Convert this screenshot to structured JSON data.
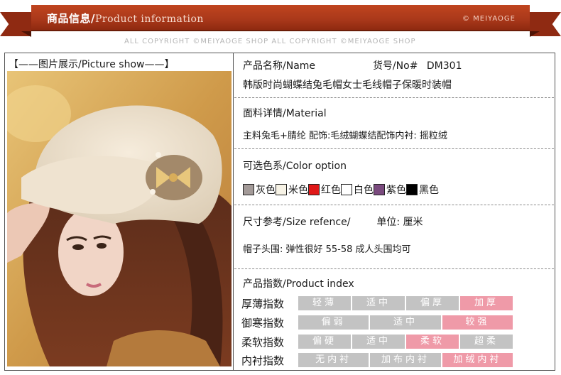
{
  "colors": {
    "ribbon": "#a9381a",
    "active_index": "#ef9aa8",
    "inactive_index": "#c3c3c3"
  },
  "header": {
    "title_cn": "商品信息/",
    "title_en": "Product information",
    "brand": "© MEIYAOGE",
    "copyright": "ALL COPYRIGHT ©MEIYAOGE SHOP  ALL COPYRIGHT ©MEIYAOGE SHOP"
  },
  "picture": {
    "title": "【——图片展示/Picture show——】"
  },
  "product": {
    "name_label": "产品名称/Name",
    "sku_label": "货号/No#",
    "sku": "DM301",
    "name": "韩版时尚蝴蝶结兔毛帽女士毛线帽子保暖时装帽"
  },
  "material": {
    "title": "面料详情/Material",
    "text": "主料兔毛+腈纶  配饰:毛绒蝴蝶结配饰内衬: 摇粒绒"
  },
  "color_option": {
    "title": "可选色系/Color option",
    "items": [
      {
        "label": "灰色",
        "color": "#a39a98"
      },
      {
        "label": "米色",
        "color": "#f7f3e6"
      },
      {
        "label": "红色",
        "color": "#e01818"
      },
      {
        "label": "白色",
        "color": "#ffffff"
      },
      {
        "label": "紫色",
        "color": "#7a4a7e"
      },
      {
        "label": "黑色",
        "color": "#000000"
      }
    ]
  },
  "size": {
    "title": "尺寸参考/Size refence/",
    "unit_label": "单位: 厘米",
    "text": "帽子头围: 弹性很好  55-58  成人头围均可"
  },
  "product_index": {
    "title": "产品指数/Product index",
    "rows": [
      {
        "label": "厚薄指数",
        "selected": 3,
        "cells": [
          "轻薄",
          "适中",
          "偏厚",
          "加厚"
        ]
      },
      {
        "label": "御寒指数",
        "selected": 2,
        "cells": [
          "偏弱",
          "适中",
          "较强"
        ]
      },
      {
        "label": "柔软指数",
        "selected": 2,
        "cells": [
          "偏硬",
          "适中",
          "柔软",
          "超柔"
        ]
      },
      {
        "label": "内衬指数",
        "selected": 2,
        "cells": [
          "无内衬",
          "加布内衬",
          "加绒内衬"
        ]
      }
    ]
  }
}
